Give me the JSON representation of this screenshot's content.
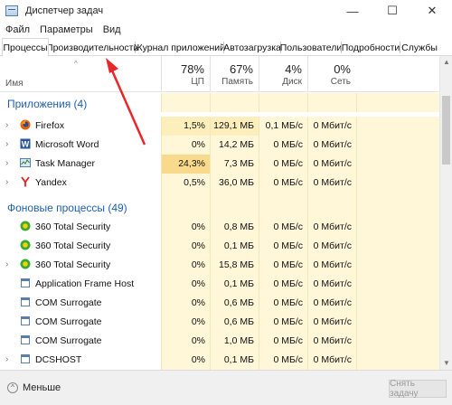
{
  "window": {
    "title": "Диспетчер задач",
    "controls": [
      "—",
      "☐",
      "✕"
    ]
  },
  "menu": [
    "Файл",
    "Параметры",
    "Вид"
  ],
  "tabs": [
    "Процессы",
    "Производительность",
    "Журнал приложений",
    "Автозагрузка",
    "Пользователи",
    "Подробности",
    "Службы"
  ],
  "columns": {
    "name": "Имя",
    "cpu": {
      "pct": "78%",
      "label": "ЦП"
    },
    "memory": {
      "pct": "67%",
      "label": "Память"
    },
    "disk": {
      "pct": "4%",
      "label": "Диск"
    },
    "network": {
      "pct": "0%",
      "label": "Сеть"
    }
  },
  "groups": {
    "apps": "Приложения (4)",
    "background": "Фоновые процессы (49)"
  },
  "apps": [
    {
      "name": "Firefox",
      "cpu": "1,5%",
      "mem": "129,1 МБ",
      "disk": "0,1 МБ/с",
      "net": "0 Мбит/с",
      "icon": "firefox-icon"
    },
    {
      "name": "Microsoft Word",
      "cpu": "0%",
      "mem": "14,2 МБ",
      "disk": "0 МБ/с",
      "net": "0 Мбит/с",
      "icon": "word-icon"
    },
    {
      "name": "Task Manager",
      "cpu": "24,3%",
      "mem": "7,3 МБ",
      "disk": "0 МБ/с",
      "net": "0 Мбит/с",
      "icon": "task-manager-icon"
    },
    {
      "name": "Yandex",
      "cpu": "0,5%",
      "mem": "36,0 МБ",
      "disk": "0 МБ/с",
      "net": "0 Мбит/с",
      "icon": "yandex-icon"
    }
  ],
  "background": [
    {
      "name": "360 Total Security",
      "cpu": "0%",
      "mem": "0,8 МБ",
      "disk": "0 МБ/с",
      "net": "0 Мбит/с",
      "icon": "360-icon"
    },
    {
      "name": "360 Total Security",
      "cpu": "0%",
      "mem": "0,1 МБ",
      "disk": "0 МБ/с",
      "net": "0 Мбит/с",
      "icon": "360-icon"
    },
    {
      "name": "360 Total Security",
      "cpu": "0%",
      "mem": "15,8 МБ",
      "disk": "0 МБ/с",
      "net": "0 Мбит/с",
      "icon": "360-icon"
    },
    {
      "name": "Application Frame Host",
      "cpu": "0%",
      "mem": "0,1 МБ",
      "disk": "0 МБ/с",
      "net": "0 Мбит/с",
      "icon": "service-icon"
    },
    {
      "name": "COM Surrogate",
      "cpu": "0%",
      "mem": "0,6 МБ",
      "disk": "0 МБ/с",
      "net": "0 Мбит/с",
      "icon": "service-icon"
    },
    {
      "name": "COM Surrogate",
      "cpu": "0%",
      "mem": "0,6 МБ",
      "disk": "0 МБ/с",
      "net": "0 Мбит/с",
      "icon": "service-icon"
    },
    {
      "name": "COM Surrogate",
      "cpu": "0%",
      "mem": "1,0 МБ",
      "disk": "0 МБ/с",
      "net": "0 Мбит/с",
      "icon": "service-icon"
    },
    {
      "name": "DCSHOST",
      "cpu": "0%",
      "mem": "0,1 МБ",
      "disk": "0 МБ/с",
      "net": "0 Мбит/с",
      "icon": "service-icon"
    }
  ],
  "bottom": {
    "fewer_label": "Меньше",
    "end_task_label": "Снять задачу"
  },
  "colors": {
    "group_title": "#1e5fae",
    "cell_bg": "#fff7d8",
    "cell_hot": "#f9d98c",
    "annotation_arrow": "#e8262a"
  }
}
